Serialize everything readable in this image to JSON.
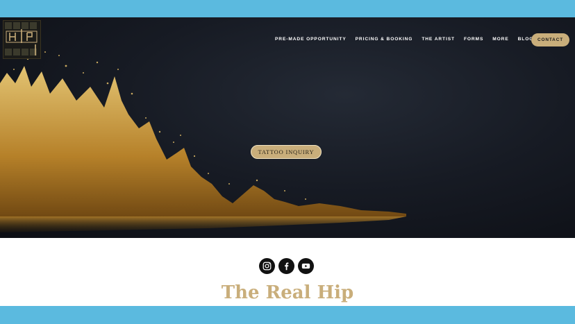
{
  "header": {
    "logo_icon": "hip-monogram-logo",
    "nav": [
      "PRE-MADE OPPORTUNITY",
      "PRICING & BOOKING",
      "THE ARTIST",
      "FORMS",
      "MORE",
      "BLOG"
    ],
    "contact_label": "CONTACT"
  },
  "hero": {
    "cta_label": "TATTOO INQUIRY",
    "background": "gold-particle-splash"
  },
  "social": {
    "items": [
      "instagram-icon",
      "facebook-icon",
      "youtube-icon"
    ]
  },
  "main": {
    "title": "The Real Hip"
  },
  "colors": {
    "band": "#5bbadf",
    "gold": "#c9ae7b",
    "hero_dark": "#171b24"
  }
}
